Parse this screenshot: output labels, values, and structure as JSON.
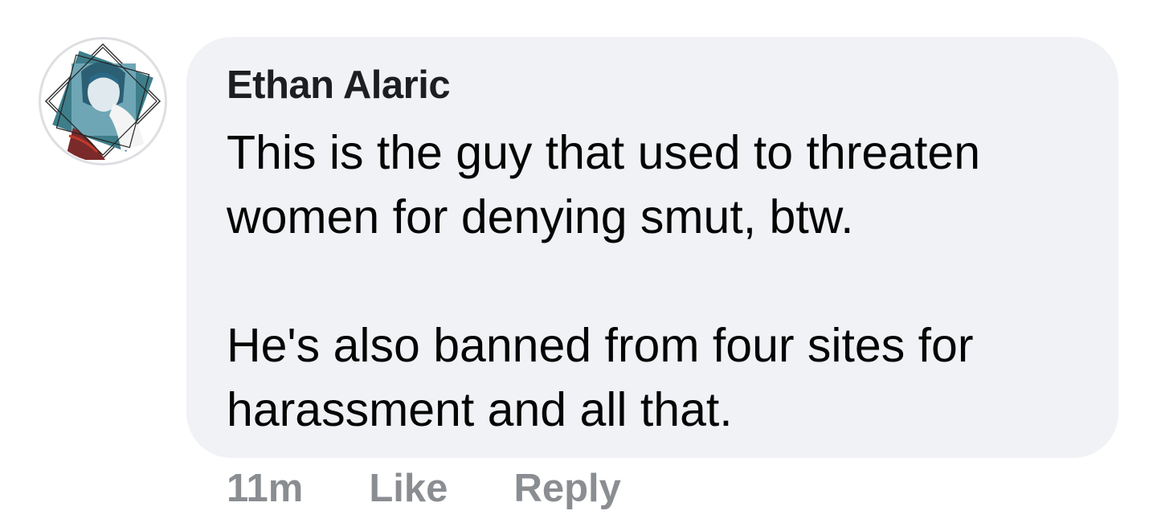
{
  "comment": {
    "author": "Ethan Alaric",
    "paragraphs": [
      "This is the guy that used to threaten women for denying smut, btw.",
      "He's also banned from four sites for harassment and all that."
    ],
    "avatar_icon": "profile-avatar-icon"
  },
  "actions": {
    "timestamp": "11m",
    "like_label": "Like",
    "reply_label": "Reply"
  },
  "colors": {
    "bubble": "#f0f2f5",
    "author": "#1c1e21",
    "text": "#050505",
    "meta": "#8a8d91"
  }
}
